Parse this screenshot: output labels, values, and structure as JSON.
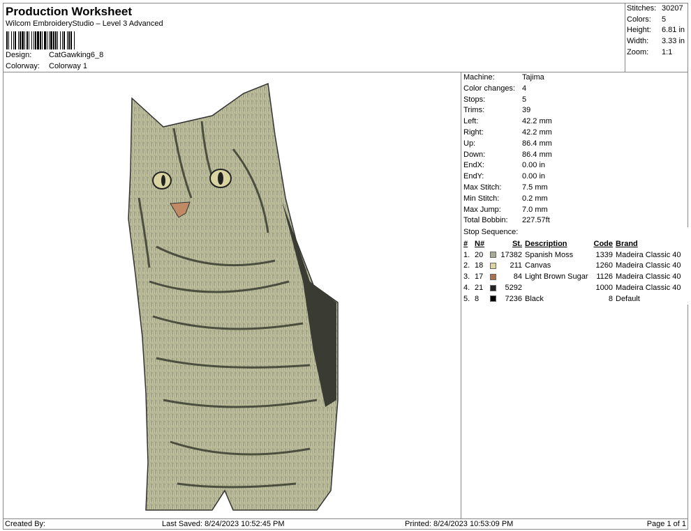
{
  "header": {
    "title": "Production Worksheet",
    "subtitle": "Wilcom EmbroideryStudio – Level 3 Advanced",
    "design_label": "Design:",
    "design": "CatGawking6_8",
    "colorway_label": "Colorway:",
    "colorway": "Colorway 1"
  },
  "stats": [
    {
      "label": "Stitches:",
      "value": "30207"
    },
    {
      "label": "Colors:",
      "value": "5"
    },
    {
      "label": "Height:",
      "value": "6.81 in"
    },
    {
      "label": "Width:",
      "value": "3.33 in"
    },
    {
      "label": "Zoom:",
      "value": "1:1"
    }
  ],
  "info": [
    {
      "label": "Machine:",
      "value": "Tajima"
    },
    {
      "label": "Color changes:",
      "value": "4"
    },
    {
      "label": "Stops:",
      "value": "5"
    },
    {
      "label": "Trims:",
      "value": "39"
    },
    {
      "label": "Left:",
      "value": "42.2 mm"
    },
    {
      "label": "Right:",
      "value": "42.2 mm"
    },
    {
      "label": "Up:",
      "value": "86.4 mm"
    },
    {
      "label": "Down:",
      "value": "86.4 mm"
    },
    {
      "label": "EndX:",
      "value": "0.00 in"
    },
    {
      "label": "EndY:",
      "value": "0.00 in"
    },
    {
      "label": "Max Stitch:",
      "value": "7.5 mm"
    },
    {
      "label": "Min Stitch:",
      "value": "0.2 mm"
    },
    {
      "label": "Max Jump:",
      "value": "7.0 mm"
    },
    {
      "label": "Total Bobbin:",
      "value": "227.57ft"
    }
  ],
  "stop_sequence": {
    "title": "Stop Sequence:",
    "headers": {
      "num": "#",
      "n": "N#",
      "st": "St.",
      "desc": "Description",
      "code": "Code",
      "brand": "Brand"
    },
    "rows": [
      {
        "num": "1.",
        "n": "20",
        "color": "#a8aa98",
        "st": "17382",
        "desc": "Spanish Moss",
        "code": "1339",
        "brand": "Madeira Classic 40"
      },
      {
        "num": "2.",
        "n": "18",
        "color": "#d9d4a2",
        "st": "211",
        "desc": "Canvas",
        "code": "1260",
        "brand": "Madeira Classic 40"
      },
      {
        "num": "3.",
        "n": "17",
        "color": "#a87250",
        "st": "84",
        "desc": "Light Brown Sugar",
        "code": "1126",
        "brand": "Madeira Classic 40"
      },
      {
        "num": "4.",
        "n": "21",
        "color": "#222222",
        "st": "5292",
        "desc": "",
        "code": "1000",
        "brand": "Madeira Classic 40"
      },
      {
        "num": "5.",
        "n": "8",
        "color": "#000000",
        "st": "7236",
        "desc": "Black",
        "code": "8",
        "brand": "Default"
      }
    ]
  },
  "footer": {
    "created": "Created By:",
    "saved": "Last Saved: 8/24/2023 10:52:45 PM",
    "printed": "Printed: 8/24/2023 10:53:09 PM",
    "page": "Page 1 of 1"
  }
}
